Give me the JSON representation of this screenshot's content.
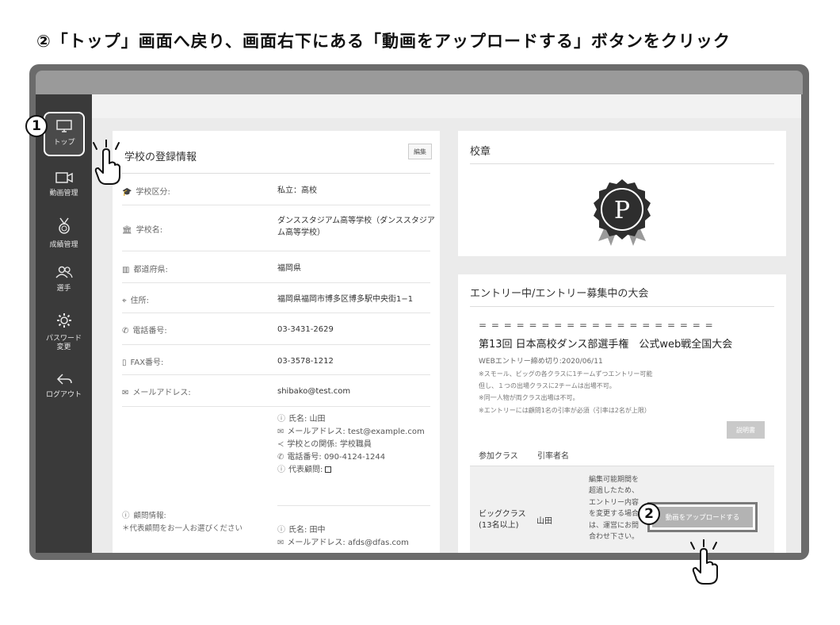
{
  "instruction": "②「トップ」画面へ戻り、画面右下にある「動画をアップロードする」ボタンをクリック",
  "callouts": {
    "step1": "1",
    "step2": "2"
  },
  "sidebar": {
    "items": [
      {
        "label": "トップ",
        "icon": "monitor-icon",
        "glyph": "🖵"
      },
      {
        "label": "動画管理",
        "icon": "video-camera-icon",
        "glyph": "▭"
      },
      {
        "label": "成績管理",
        "icon": "medal-icon",
        "glyph": "⍜"
      },
      {
        "label": "選手",
        "icon": "users-icon",
        "glyph": "☿"
      },
      {
        "label": "パスワード\n変更",
        "icon": "gear-icon",
        "glyph": "⚙"
      },
      {
        "label": "ログアウト",
        "icon": "logout-arrow-icon",
        "glyph": "⇚"
      }
    ]
  },
  "school_info": {
    "title": "学校の登録情報",
    "edit_label": "編集",
    "rows": [
      {
        "label": "学校区分:",
        "icon": "graduation-cap-icon",
        "glyph": "⌂",
        "value": "私立：高校"
      },
      {
        "label": "学校名:",
        "icon": "school-building-icon",
        "glyph": "⌂",
        "value": "ダンススタジアム高等学校（ダンススタジアム高等学校）"
      },
      {
        "label": "都道府県:",
        "icon": "map-icon",
        "glyph": "▥",
        "value": "福岡県"
      },
      {
        "label": "住所:",
        "icon": "location-icon",
        "glyph": "⌖",
        "value": "福岡県福岡市博多区博多駅中央街1−1"
      },
      {
        "label": "電話番号:",
        "icon": "phone-icon",
        "glyph": "✆",
        "value": "03-3431-2629"
      },
      {
        "label": "FAX番号:",
        "icon": "document-icon",
        "glyph": "▯",
        "value": "03-3578-1212"
      },
      {
        "label": "メールアドレス:",
        "icon": "envelope-icon",
        "glyph": "✉",
        "value": "shibako@test.com"
      }
    ],
    "advisor": {
      "label": "顧問情報:",
      "note": "＊代表顧問をお一人お選びください",
      "contacts": [
        {
          "name": "氏名: 山田",
          "email": "メールアドレス: test@example.com",
          "relation": "学校との関係: 学校職員",
          "phone": "電話番号: 090-4124-1244",
          "representative": "代表顧問:"
        },
        {
          "name": "氏名: 田中",
          "email": "メールアドレス: afds@dfas.com"
        }
      ]
    }
  },
  "emblem": {
    "title": "校章",
    "letter": "P"
  },
  "entry": {
    "title": "エントリー中/エントリー募集中の大会",
    "separator": "= = = = = = = = = = = = = = = = = = =",
    "competition": "第13回 日本高校ダンス部選手権　公式web戦全国大会",
    "deadline": "WEBエントリー締め切り:2020/06/11",
    "notes": [
      "※スモール、ビッグの各クラスに1チームずつエントリー可能",
      "但し、１つの出場クラスに2チームは出場不可。",
      "※同一人物が両クラス出場は不可。",
      "※エントリーには顧問1名の引率が必須（引率は2名が上限）"
    ],
    "manual_label": "説明書",
    "headers": {
      "class": "参加クラス",
      "leader": "引率者名"
    },
    "row": {
      "class_name": "ビッグクラス",
      "class_size": "(13名以上)",
      "leader": "山田",
      "edit_note": "編集可能期間を超過したため、エントリー内容を変更する場合は、運営にお問合わせ下さい。",
      "upload_label": "動画をアップロードする"
    }
  }
}
